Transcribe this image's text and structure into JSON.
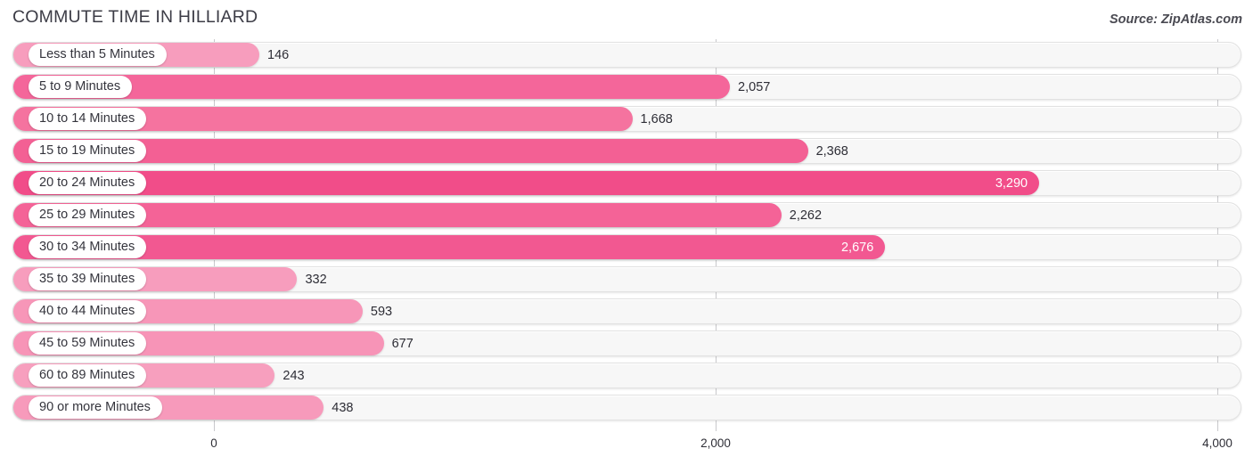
{
  "header": {
    "title": "COMMUTE TIME IN HILLIARD",
    "source": "Source: ZipAtlas.com"
  },
  "colors": {
    "bar_strong": "#F2598F",
    "bar_mid": "#F57BA6",
    "bar_light": "#F79DBD",
    "track_bg": "#F7F7F7",
    "gridline": "#C9C9CC",
    "title_text": "#3C3C46"
  },
  "chart_data": {
    "type": "bar",
    "orientation": "horizontal",
    "title": "COMMUTE TIME IN HILLIARD",
    "xlabel": "",
    "ylabel": "",
    "xlim": [
      0,
      4000
    ],
    "grid": true,
    "legend": "none",
    "tick_labels": [
      "0",
      "2,000",
      "4,000"
    ],
    "ticks": [
      0,
      2000,
      4000
    ],
    "categories": [
      "Less than 5 Minutes",
      "5 to 9 Minutes",
      "10 to 14 Minutes",
      "15 to 19 Minutes",
      "20 to 24 Minutes",
      "25 to 29 Minutes",
      "30 to 34 Minutes",
      "35 to 39 Minutes",
      "40 to 44 Minutes",
      "45 to 59 Minutes",
      "60 to 89 Minutes",
      "90 or more Minutes"
    ],
    "values": [
      146,
      2057,
      1668,
      2368,
      3290,
      2262,
      2676,
      332,
      593,
      677,
      243,
      438
    ],
    "value_labels": [
      "146",
      "2,057",
      "1,668",
      "2,368",
      "3,290",
      "2,262",
      "2,676",
      "332",
      "593",
      "677",
      "243",
      "438"
    ],
    "bars": [
      {
        "label": "Less than 5 Minutes",
        "value": 146,
        "value_label": "146",
        "color": "#F79DBD",
        "label_inside": false
      },
      {
        "label": "5 to 9 Minutes",
        "value": 2057,
        "value_label": "2,057",
        "color": "#F4669A",
        "label_inside": false
      },
      {
        "label": "10 to 14 Minutes",
        "value": 1668,
        "value_label": "1,668",
        "color": "#F5739F",
        "label_inside": false
      },
      {
        "label": "15 to 19 Minutes",
        "value": 2368,
        "value_label": "2,368",
        "color": "#F36094",
        "label_inside": false
      },
      {
        "label": "20 to 24 Minutes",
        "value": 3290,
        "value_label": "3,290",
        "color": "#F14D89",
        "label_inside": true
      },
      {
        "label": "25 to 29 Minutes",
        "value": 2262,
        "value_label": "2,262",
        "color": "#F46397",
        "label_inside": false
      },
      {
        "label": "30 to 34 Minutes",
        "value": 2676,
        "value_label": "2,676",
        "color": "#F25891",
        "label_inside": true
      },
      {
        "label": "35 to 39 Minutes",
        "value": 332,
        "value_label": "332",
        "color": "#F79DBD",
        "label_inside": false
      },
      {
        "label": "40 to 44 Minutes",
        "value": 593,
        "value_label": "593",
        "color": "#F796B8",
        "label_inside": false
      },
      {
        "label": "45 to 59 Minutes",
        "value": 677,
        "value_label": "677",
        "color": "#F794B7",
        "label_inside": false
      },
      {
        "label": "60 to 89 Minutes",
        "value": 243,
        "value_label": "243",
        "color": "#F79FBE",
        "label_inside": false
      },
      {
        "label": "90 or more Minutes",
        "value": 438,
        "value_label": "438",
        "color": "#F79ABB",
        "label_inside": false
      }
    ]
  }
}
